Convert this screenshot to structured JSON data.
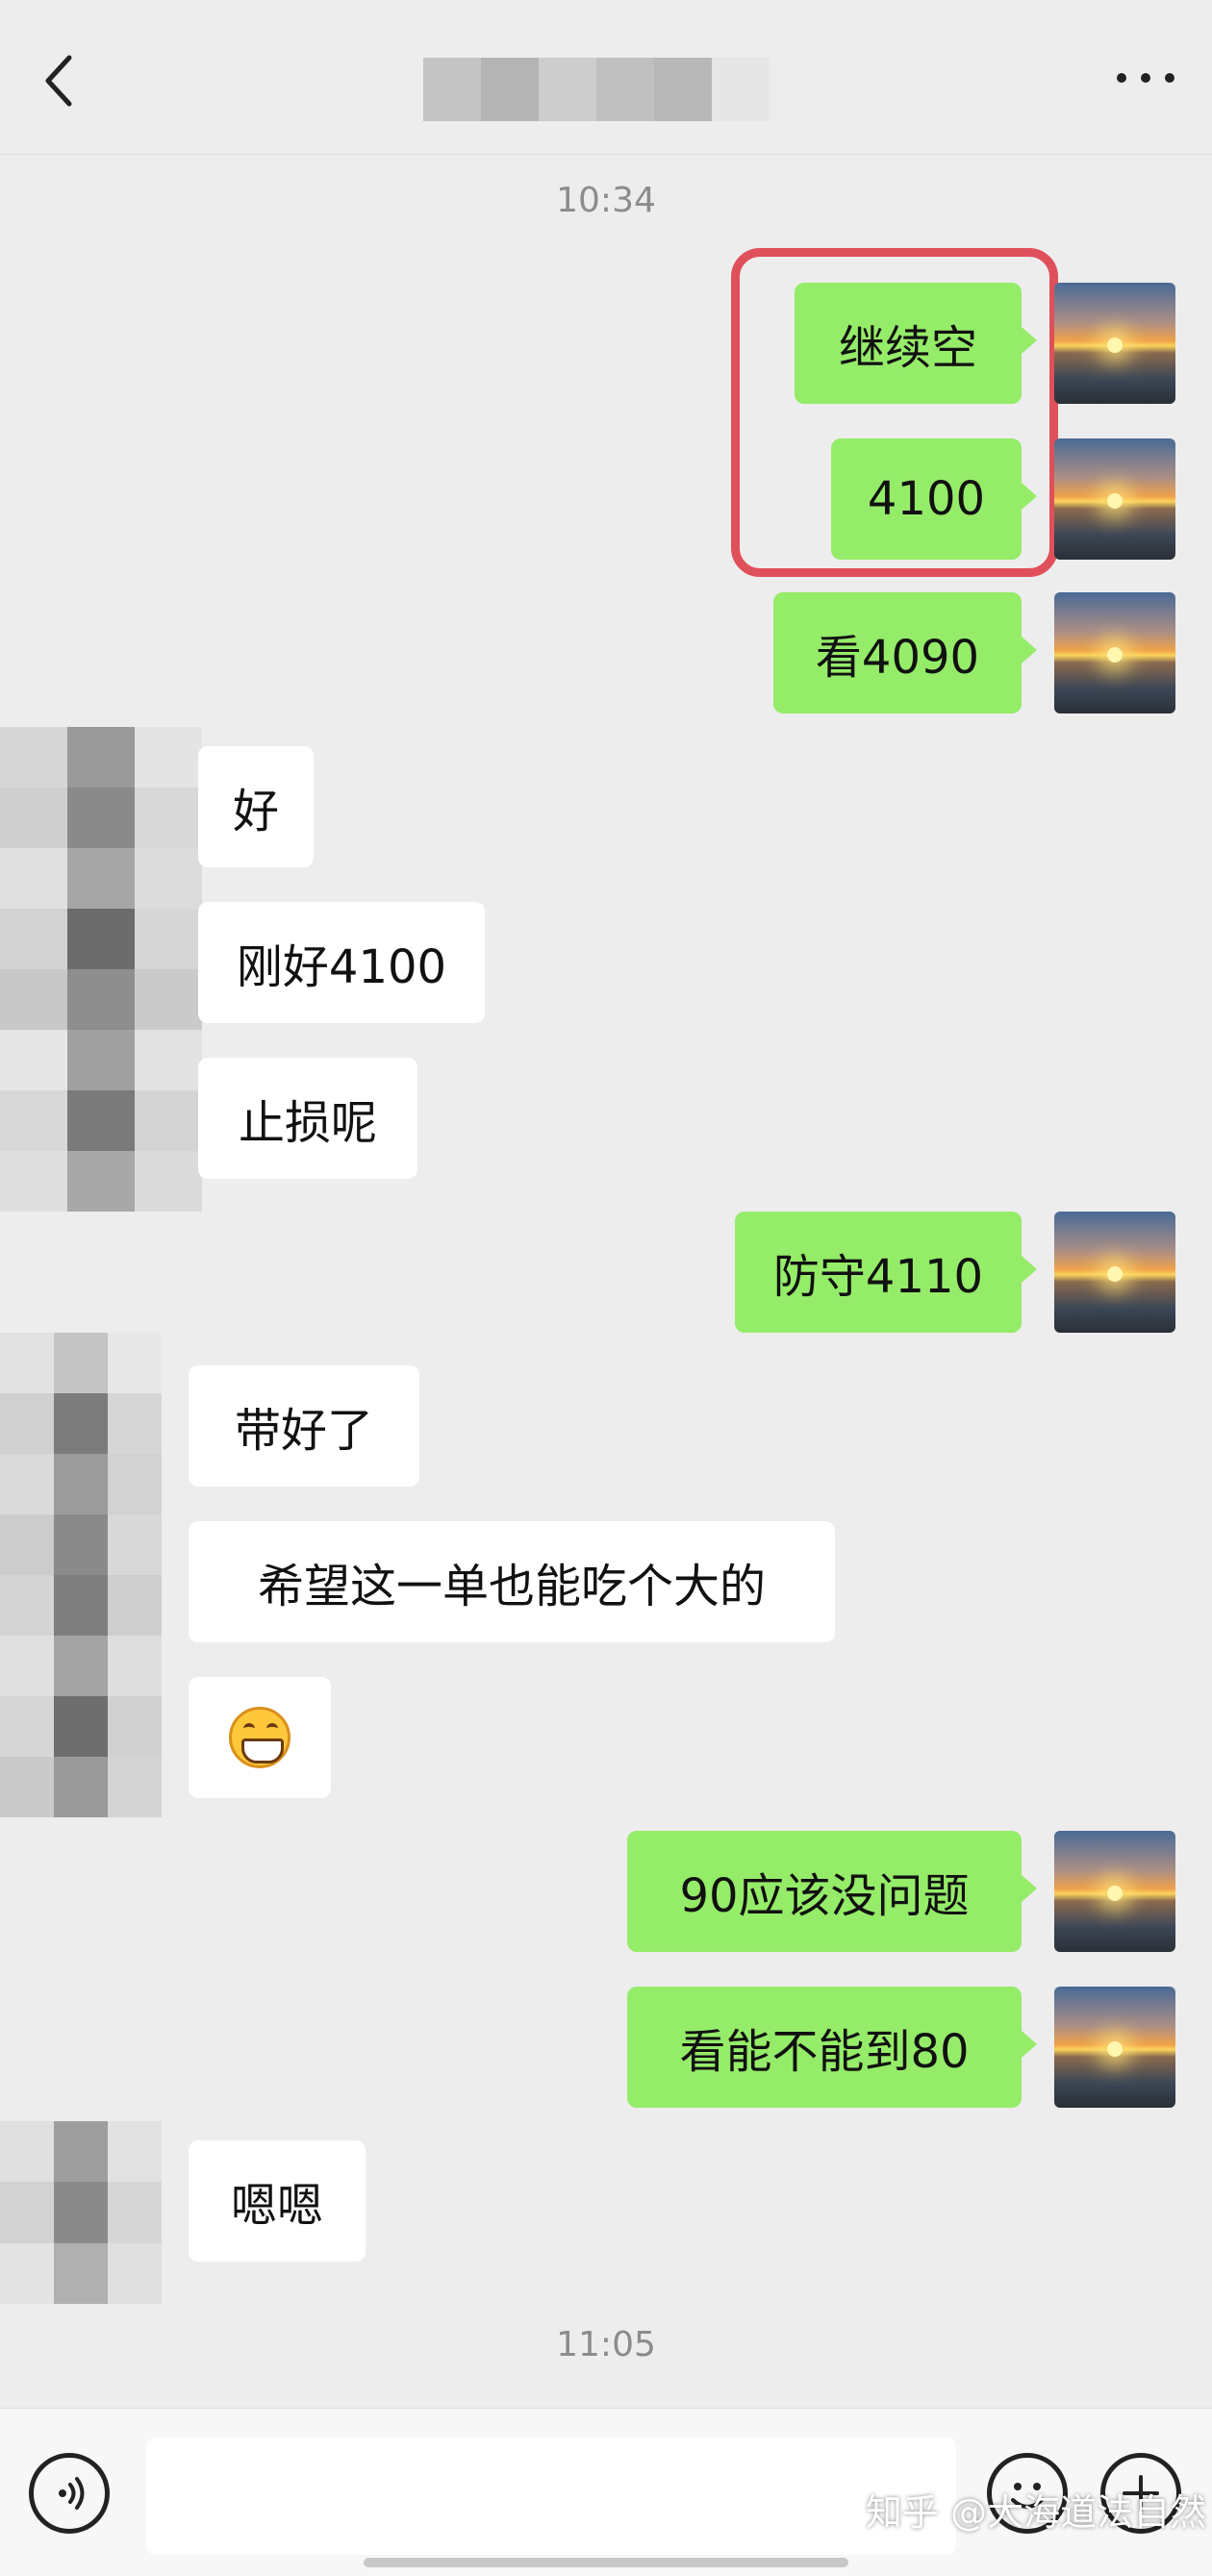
{
  "header": {
    "title": "",
    "back_icon": "chevron-left-icon",
    "more_icon": "ellipsis-icon"
  },
  "timestamps": {
    "first": "10:34",
    "second": "11:05"
  },
  "messages": [
    {
      "side": "me",
      "text": "继续空"
    },
    {
      "side": "me",
      "text": "4100"
    },
    {
      "side": "me",
      "text": "看4090"
    },
    {
      "side": "them",
      "text": "好"
    },
    {
      "side": "them",
      "text": "刚好4100"
    },
    {
      "side": "them",
      "text": "止损呢"
    },
    {
      "side": "me",
      "text": "防守4110"
    },
    {
      "side": "them",
      "text": "带好了"
    },
    {
      "side": "them",
      "text": "希望这一单也能吃个大的"
    },
    {
      "side": "them",
      "text": "",
      "emoji": "grinning-face-icon"
    },
    {
      "side": "me",
      "text": "90应该没问题"
    },
    {
      "side": "me",
      "text": "看能不能到80"
    },
    {
      "side": "them",
      "text": "嗯嗯"
    }
  ],
  "input_bar": {
    "voice_icon": "voice-icon",
    "emoji_icon": "emoji-icon",
    "add_icon": "plus-icon",
    "watermark": "知乎 @大海道法自然"
  },
  "colors": {
    "my_bubble": "#95ec69",
    "their_bubble": "#ffffff",
    "background": "#ededed",
    "highlight": "#e0505a"
  }
}
